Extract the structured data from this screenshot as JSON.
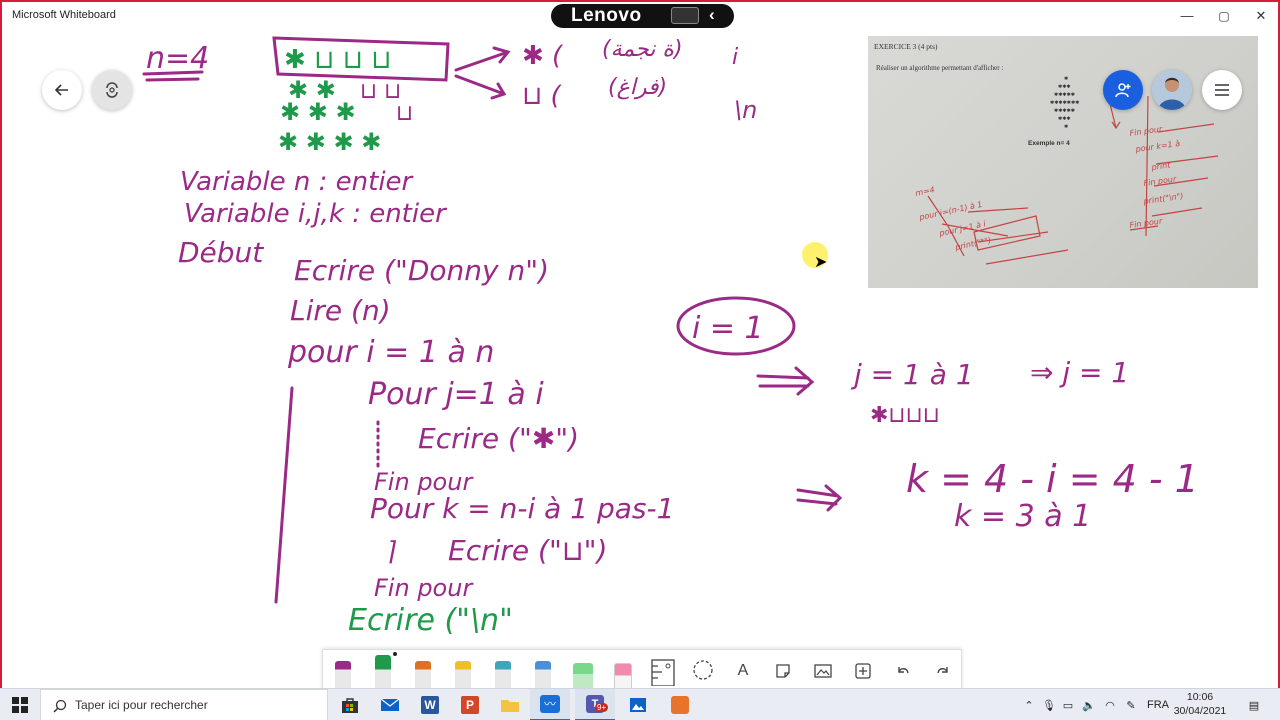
{
  "window": {
    "title": "Microsoft Whiteboard",
    "oem_brand": "Lenovo",
    "controls": {
      "minimize": "—",
      "maximize": "▢",
      "close": "✕"
    }
  },
  "canvas": {
    "pen_colors": {
      "purple": "#9b2a86",
      "green": "#1f9a4a",
      "red": "#c44444"
    },
    "board_text": {
      "n_eq": "n=4",
      "stars_row": "✱ ⊔ ⊔ ⊔",
      "var1": "Variable n : entier",
      "var2": "Variable i,j,k : entier",
      "debut": "Début",
      "l1": "Ecrire (\"Donny n\")",
      "l2": "Lire (n)",
      "l3": "pour i = 1 à n",
      "l4": "Pour j=1 à i",
      "l5": "Ecrire (\"✱\")",
      "l6": "Fin pour",
      "l7": "Pour k = n-i à 1 pas-1",
      "l8": "Ecrire (\"⊔\")",
      "l9": "Fin pour",
      "l10": "Ecrire (\"\\n\"",
      "r1": "✱ (",
      "r2": "⊔ (",
      "r3": "\\n",
      "i_eq": "i = 1",
      "j_range": "j = 1 à 1",
      "j_res": "⇒ j = 1",
      "star_spaces": "✱⊔⊔⊔",
      "k_calc": "k = 4 - i = 4 - 1",
      "k_range": "k = 3 à 1"
    },
    "exercise_image": {
      "title": "EXERCICE 3 (4 pts)",
      "subtitle": "Réaliser un algorithme permettant d'afficher :",
      "example": "Exemple n= 4"
    }
  },
  "taskbar": {
    "search_placeholder": "Taper ici pour rechercher",
    "language": "FRA",
    "time": "10:06",
    "date": "30/04/2021",
    "teams_badge": "9+"
  }
}
